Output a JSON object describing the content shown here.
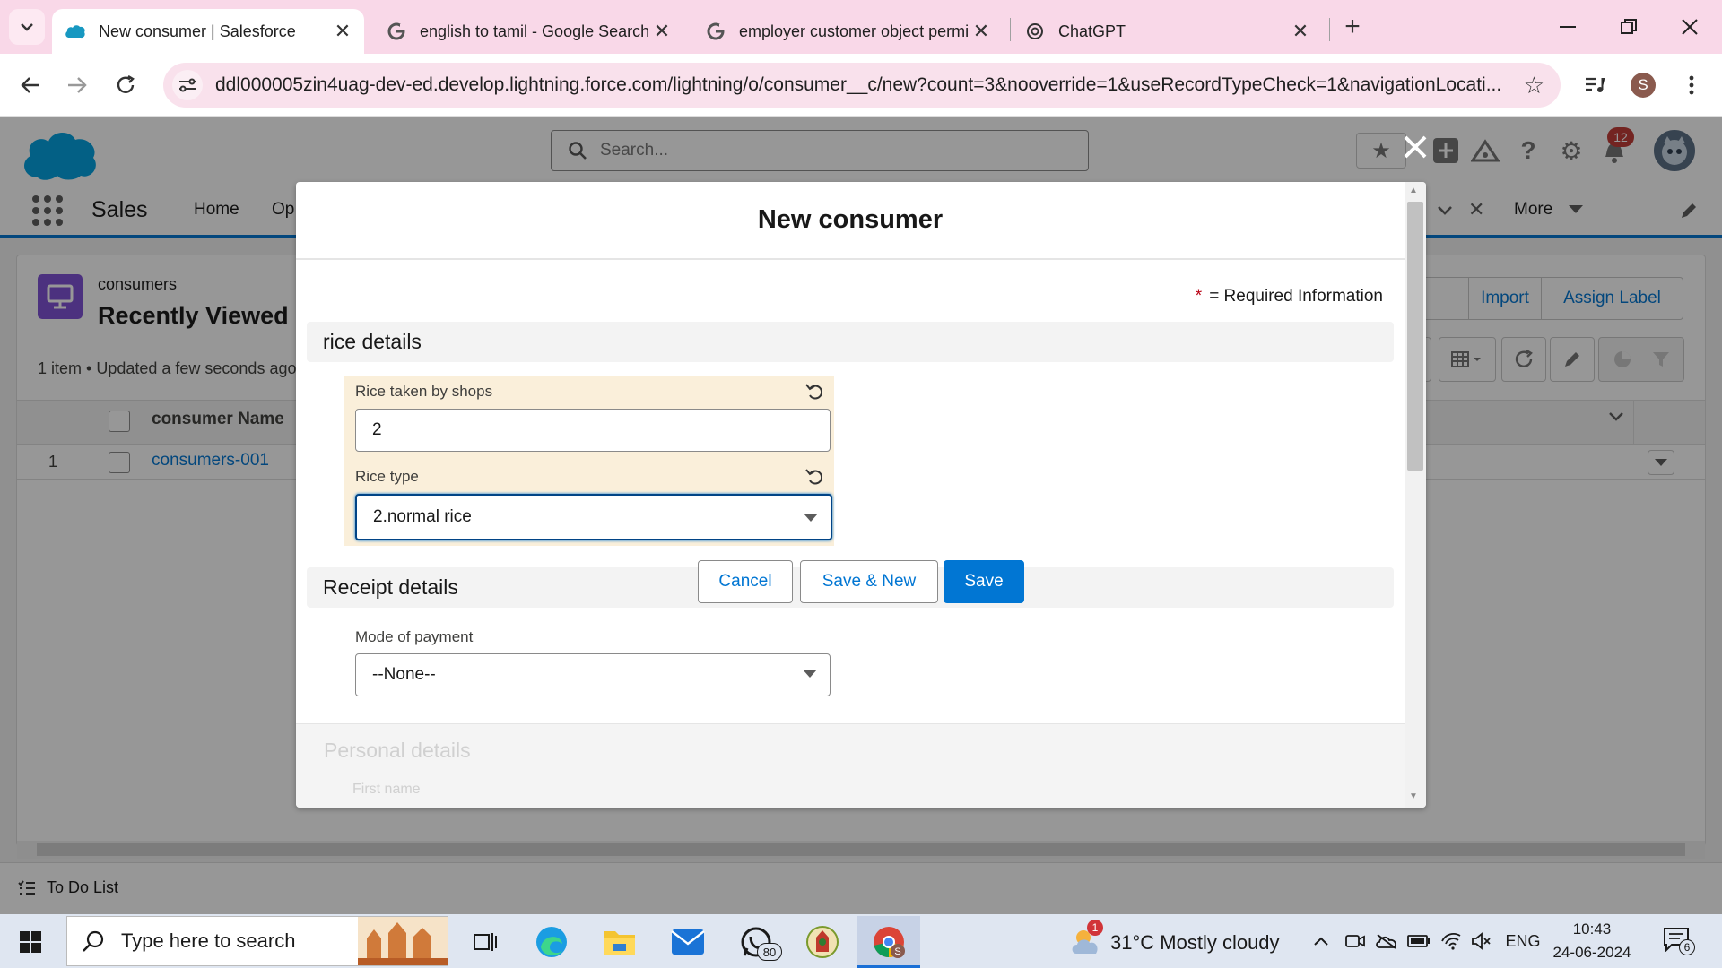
{
  "browser": {
    "tabs": [
      {
        "title": "New consumer | Salesforce",
        "icon": "salesforce-cloud-icon",
        "active": true
      },
      {
        "title": "english to tamil - Google Search",
        "icon": "google-g-icon",
        "active": false
      },
      {
        "title": "employer customer object permissions",
        "icon": "google-g-icon",
        "active": false
      },
      {
        "title": "ChatGPT",
        "icon": "chatgpt-icon",
        "active": false
      }
    ],
    "url": "ddl000005zin4uag-dev-ed.develop.lightning.force.com/lightning/o/consumer__c/new?count=3&nooverride=1&useRecordTypeCheck=1&navigationLocati...",
    "profile_initial": "S"
  },
  "salesforce": {
    "search_placeholder": "Search...",
    "notification_count": "12",
    "app_name": "Sales",
    "nav_items": [
      "Home",
      "Op"
    ],
    "nav_more": "More",
    "object_label": "consumers",
    "list_view": "Recently Viewed",
    "list_meta": "1 item • Updated a few seconds ago",
    "buttons": {
      "import": "Import",
      "assign_label": "Assign Label"
    },
    "table": {
      "header_name": "consumer Name",
      "rows": [
        {
          "num": "1",
          "name": "consumers-001"
        }
      ]
    },
    "utility_bar": {
      "todo": "To Do List"
    }
  },
  "modal": {
    "title": "New consumer",
    "required_marker": "*",
    "required_note": "= Required Information",
    "sections": {
      "rice": "rice details",
      "receipt": "Receipt details",
      "personal": "Personal details"
    },
    "fields": {
      "rice_taken_label": "Rice taken by shops",
      "rice_taken_value": "2",
      "rice_type_label": "Rice type",
      "rice_type_value": "2.normal rice",
      "mode_payment_label": "Mode of payment",
      "mode_payment_value": "--None--",
      "first_name_label": "First name"
    },
    "footer": {
      "cancel": "Cancel",
      "save_new": "Save & New",
      "save": "Save"
    }
  },
  "taskbar": {
    "search_placeholder": "Type here to search",
    "whatsapp_badge": "80",
    "weather_badge": "1",
    "weather": "31°C  Mostly cloudy",
    "language": "ENG",
    "time": "10:43",
    "date": "24-06-2024",
    "notifications_count": "6"
  },
  "colors": {
    "brand": "#0176d3",
    "tabbar": "#f9d8e8",
    "edited_field": "#faefda",
    "object_icon": "#7f50d6"
  }
}
